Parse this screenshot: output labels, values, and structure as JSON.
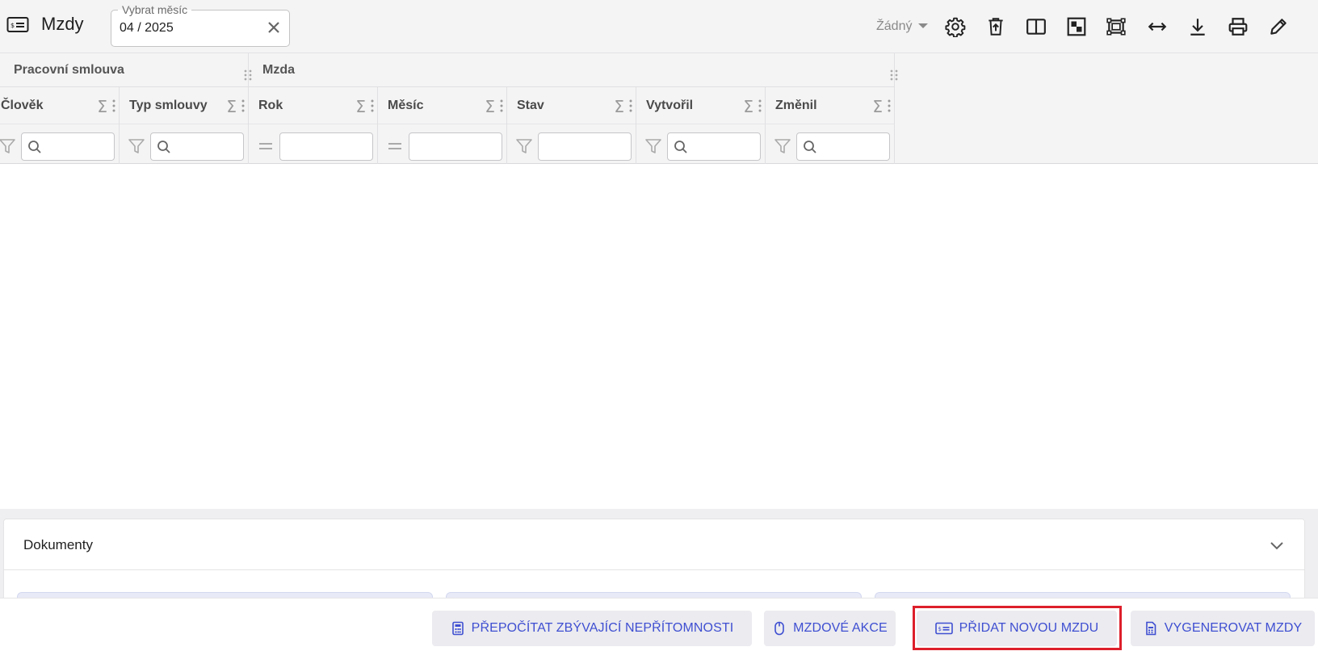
{
  "header": {
    "title": "Mzdy",
    "month_label": "Vybrat měsíc",
    "month_value": "04 / 2025",
    "view_select": "Žádný",
    "toolbar_icons": [
      "settings-icon",
      "delete-upload-icon",
      "split-view-icon",
      "layout-icon",
      "fullscreen-icon",
      "expand-width-icon",
      "download-icon",
      "print-icon",
      "edit-icon"
    ]
  },
  "grid": {
    "groups": [
      {
        "label": "Pracovní smlouva"
      },
      {
        "label": "Mzda"
      }
    ],
    "columns": [
      {
        "title": "Člověk",
        "filter": "search"
      },
      {
        "title": "Typ smlouvy",
        "filter": "search"
      },
      {
        "title": "Rok",
        "filter": "equals"
      },
      {
        "title": "Měsíc",
        "filter": "equals"
      },
      {
        "title": "Stav",
        "filter": "text"
      },
      {
        "title": "Vytvořil",
        "filter": "search"
      },
      {
        "title": "Změnil",
        "filter": "search"
      }
    ],
    "sigma": "Σ"
  },
  "documents": {
    "title": "Dokumenty"
  },
  "actions": {
    "recalc": "PŘEPOČÍTAT ZBÝVAJÍCÍ NEPŘÍTOMNOSTI",
    "payroll_actions": "MZDOVÉ AKCE",
    "add_salary": "PŘIDAT NOVOU MZDU",
    "generate": "VYGENEROVAT MZDY"
  },
  "colors": {
    "accent": "#3f4fd1",
    "highlight": "#dd1f2b"
  }
}
